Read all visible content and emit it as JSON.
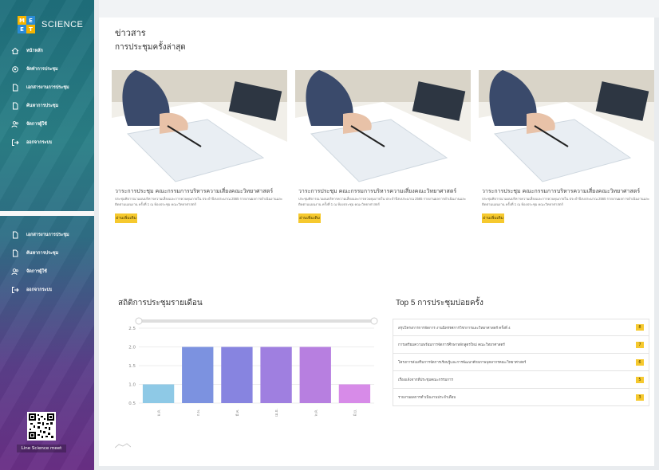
{
  "brand": {
    "name": "SCIENCE",
    "logo_letters": [
      "M",
      "E",
      "E",
      "T"
    ]
  },
  "sidebar": {
    "items": [
      {
        "label": "หน้าหลัก",
        "icon": "home-icon"
      },
      {
        "label": "จัดทำการประชุม",
        "icon": "gear-icon"
      },
      {
        "label": "เอกสารงานการประชุม",
        "icon": "document-icon"
      },
      {
        "label": "ค้นหาการประชุม",
        "icon": "document-icon"
      },
      {
        "label": "จัดการผู้ใช้",
        "icon": "users-icon"
      },
      {
        "label": "ออกจากระบบ",
        "icon": "logout-icon"
      }
    ],
    "items_bottom": [
      {
        "label": "เอกสารงานการประชุม",
        "icon": "document-icon"
      },
      {
        "label": "ค้นหาการประชุม",
        "icon": "document-icon"
      },
      {
        "label": "จัดการผู้ใช้",
        "icon": "users-icon"
      },
      {
        "label": "ออกจากระบบ",
        "icon": "logout-icon"
      }
    ],
    "qr_label": "Line Science meet"
  },
  "main": {
    "title": "ข่าวสาร",
    "subtitle": "การประชุมครั้งล่าสุด",
    "cards": [
      {
        "title": "วาระการประชุม คณะกรรมการบริหารความเสี่ยงคณะวิทยาศาสตร์",
        "desc": "ประชุมพิจารณาแผนบริหารความเสี่ยงและการควบคุมภายใน ประจำปีงบประมาณ 2565 รายงานผลการดำเนินงานและติดตามแผนงาน ครั้งที่ 1 ณ ห้องประชุม คณะวิทยาศาสตร์",
        "button": "อ่านเพิ่มเติม"
      },
      {
        "title": "วาระการประชุม คณะกรรมการบริหารความเสี่ยงคณะวิทยาศาสตร์",
        "desc": "ประชุมพิจารณาแผนบริหารความเสี่ยงและการควบคุมภายใน ประจำปีงบประมาณ 2565 รายงานผลการดำเนินงานและติดตามแผนงาน ครั้งที่ 1 ณ ห้องประชุม คณะวิทยาศาสตร์",
        "button": "อ่านเพิ่มเติม"
      },
      {
        "title": "วาระการประชุม คณะกรรมการบริหารความเสี่ยงคณะวิทยาศาสตร์",
        "desc": "ประชุมพิจารณาแผนบริหารความเสี่ยงและการควบคุมภายใน ประจำปีงบประมาณ 2565 รายงานผลการดำเนินงานและติดตามแผนงาน ครั้งที่ 1 ณ ห้องประชุม คณะวิทยาศาสตร์",
        "button": "อ่านเพิ่มเติม"
      }
    ],
    "stats_title": "สถิติการประชุมรายเดือน",
    "top5_title": "Top 5 การประชุมบ่อยครั้ง",
    "top5": [
      {
        "text": "สรุปโครงการการจัดการ งานนิทรรศการวิชาการและวิทยาศาสตร์ ครั้งที่ 4",
        "count": "8"
      },
      {
        "text": "การเตรียมความพร้อมการจัดการศึกษาหลักสูตรใหม่ คณะวิทยาศาสตร์",
        "count": "7"
      },
      {
        "text": "โครงการส่งเสริมการจัดการเรียนรู้และการพัฒนาศักยภาพบุคลากรคณะวิทยาศาสตร์",
        "count": "6"
      },
      {
        "text": "เรื่องแจ้งจากที่ประชุมคณะกรรมการ",
        "count": "5"
      },
      {
        "text": "รายงานผลการดำเนินงานประจำเดือน",
        "count": "3"
      }
    ]
  },
  "chart_data": {
    "type": "bar",
    "categories": [
      "ม.ค.",
      "ก.พ.",
      "มี.ค.",
      "เม.ย.",
      "พ.ค.",
      "มิ.ย."
    ],
    "values": [
      1.0,
      2.0,
      2.0,
      2.0,
      2.0,
      1.0
    ],
    "yticks": [
      "0.5",
      "1.0",
      "1.5",
      "2.0",
      "2.5"
    ],
    "ylim": [
      0.5,
      2.5
    ],
    "colors": [
      "#8ec9e6",
      "#7c92e0",
      "#8784e0",
      "#9f7fe0",
      "#b77fe0",
      "#d78be8"
    ],
    "title": "",
    "xlabel": "",
    "ylabel": "",
    "grid": true
  }
}
